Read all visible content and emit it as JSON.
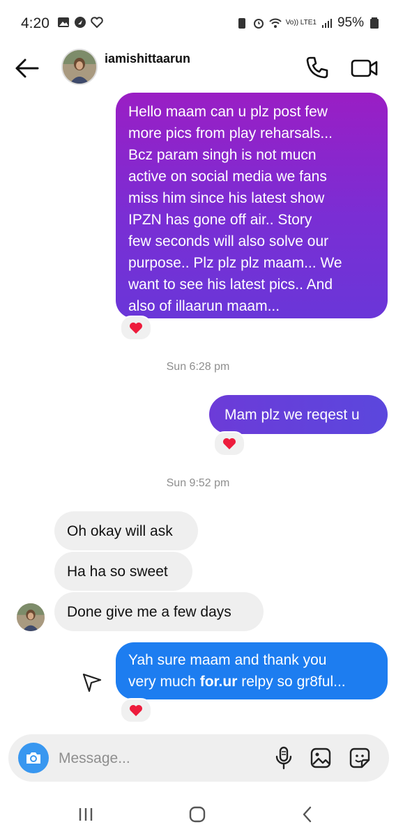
{
  "status_bar": {
    "time": "4:20",
    "battery": "95%",
    "network": "Vo)) LTE1"
  },
  "header": {
    "username": "iamishittaarun"
  },
  "messages": {
    "m1": {
      "lines": [
        "Hello maam can u plz post few",
        "more pics from play reharsals...",
        "Bcz param singh is not mucn",
        "active on social media we fans",
        "miss him since his latest show",
        "IPZN has gone off air.. Story",
        "few seconds will also solve our",
        "purpose.. Plz plz plz maam... We",
        "want to see his latest pics.. And",
        "also of illaarun maam..."
      ]
    },
    "time1": "Sun 6:28 pm",
    "m2": "Mam plz we reqest u",
    "time2": "Sun 9:52 pm",
    "r1": "Oh okay will ask",
    "r2": "Ha ha so sweet",
    "r3": "Done give me a few days",
    "m3": {
      "line1": "Yah sure maam and thank you",
      "line2a": "very much ",
      "line2b": "for.ur",
      "line2c": " relpy so gr8ful..."
    }
  },
  "composer": {
    "placeholder": "Message..."
  },
  "colors": {
    "sent_gradient_top": "#9a1ec4",
    "sent_gradient_bottom": "#6a36d8",
    "sent_blue": "#1d7df0",
    "received_bg": "#efefef",
    "heart": "#ed1c3c",
    "camera_button": "#3897f0"
  },
  "icons": [
    "back-arrow-icon",
    "phone-icon",
    "video-icon",
    "heart-icon",
    "share-icon",
    "camera-icon",
    "microphone-icon",
    "gallery-icon",
    "sticker-icon",
    "recents-icon",
    "home-icon",
    "back-nav-icon"
  ]
}
